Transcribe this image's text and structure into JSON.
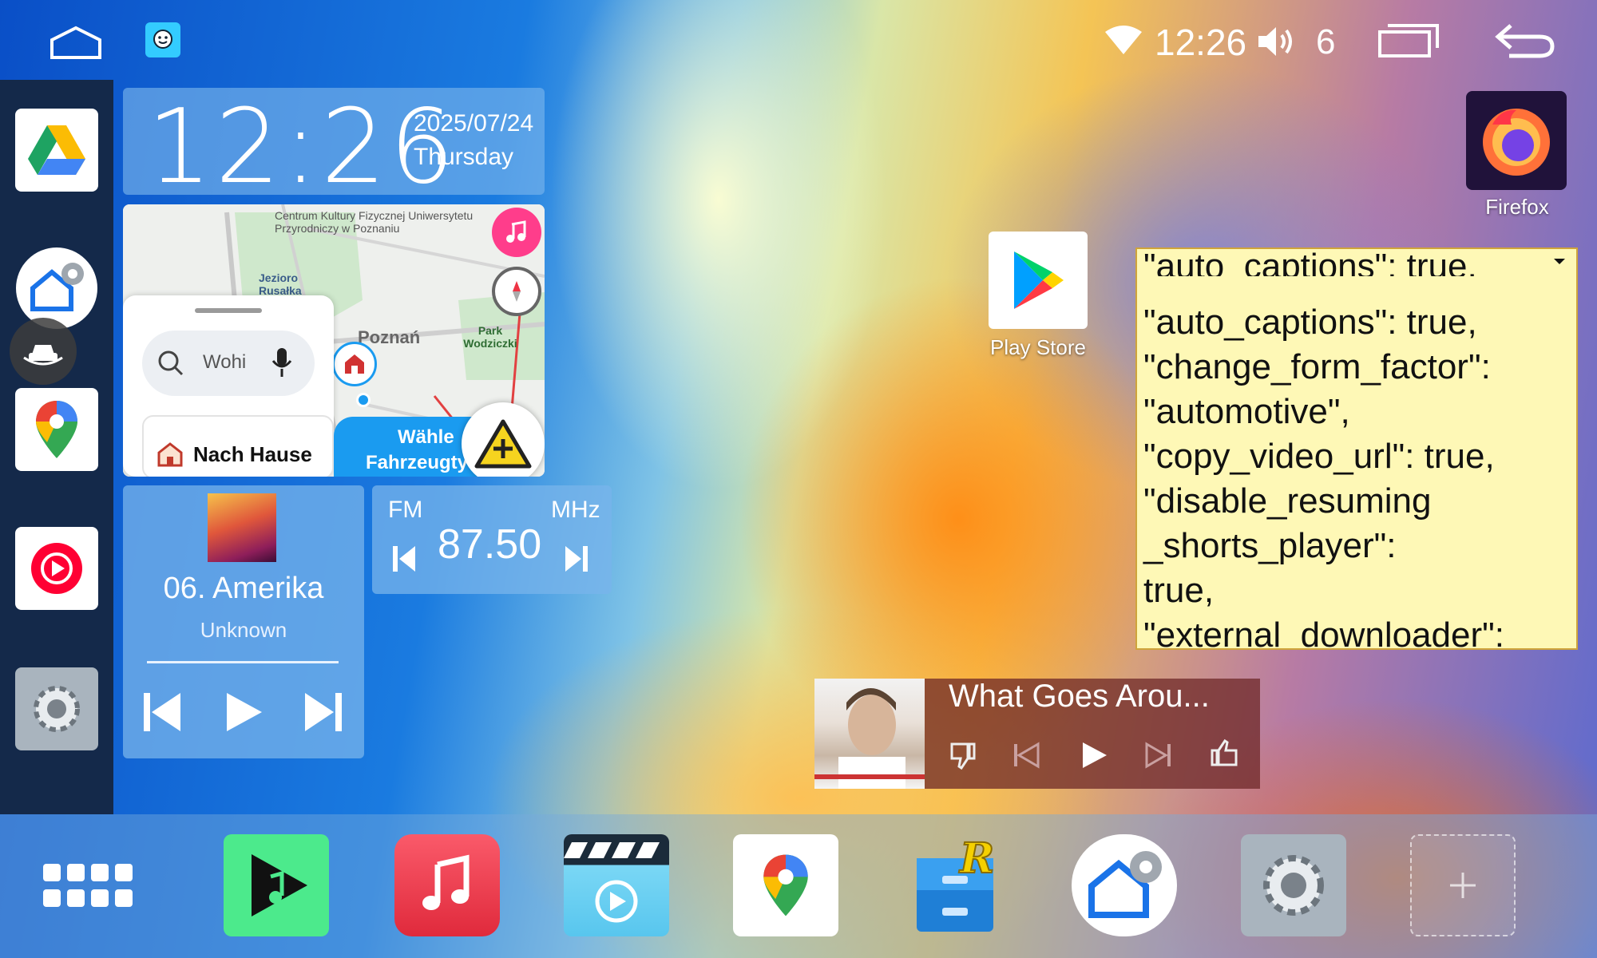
{
  "status": {
    "time": "12:26",
    "volume": "6"
  },
  "clock_widget": {
    "time": "12:26",
    "date": "2025/07/24",
    "day": "Thursday"
  },
  "map_widget": {
    "label_center": "Centrum Kultury Fizycznej Uniwersytetu Przyrodniczy w Poznaniu",
    "label_lake": "Jezioro Rusałka",
    "label_city": "Poznań",
    "label_park": "Park Wodziczki",
    "search_placeholder": "Wohi",
    "home_label": "Nach Hause",
    "vehicle_label_1": "Wähle",
    "vehicle_label_2": "Fahrzeugty"
  },
  "music_widget": {
    "title": "06. Amerika",
    "artist": "Unknown"
  },
  "radio_widget": {
    "band": "FM",
    "unit": "MHz",
    "frequency": "87.50"
  },
  "youtube_music": {
    "title": "What Goes Arou..."
  },
  "desktop_apps": {
    "firefox": "Firefox",
    "play_store": "Play Store"
  },
  "caption_box": {
    "header": "\"auto_captions\": true,",
    "lines": [
      "\"auto_captions\": true,",
      "\"change_form_factor\":",
      "\"automotive\",",
      "\"copy_video_url\": true,",
      "\"disable_resuming",
      "_shorts_player\":",
      "true,",
      "\"external_downloader\":"
    ]
  },
  "colors": {
    "rail": "#14294a",
    "accent_blue": "#1a9bf0",
    "waze_yellow": "#f6d41f"
  }
}
